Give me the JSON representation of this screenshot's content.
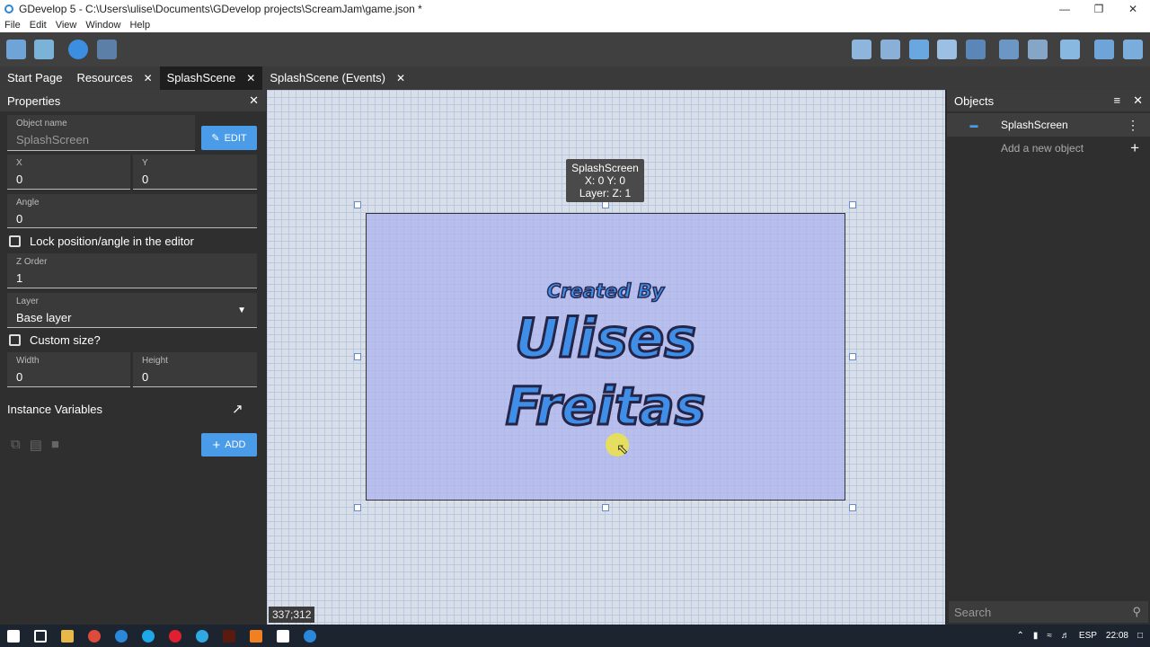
{
  "window": {
    "title": "GDevelop 5 - C:\\Users\\ulise\\Documents\\GDevelop projects\\ScreamJam\\game.json *"
  },
  "menu": [
    "File",
    "Edit",
    "View",
    "Window",
    "Help"
  ],
  "tabs": [
    {
      "label": "Start Page",
      "closable": false
    },
    {
      "label": "Resources",
      "closable": true
    },
    {
      "label": "SplashScene",
      "closable": true,
      "active": true
    },
    {
      "label": "SplashScene (Events)",
      "closable": true
    }
  ],
  "properties": {
    "title": "Properties",
    "object_name_label": "Object name",
    "object_name_value": "SplashScreen",
    "edit_label": "EDIT",
    "x_label": "X",
    "x_value": "0",
    "y_label": "Y",
    "y_value": "0",
    "angle_label": "Angle",
    "angle_value": "0",
    "lock_label": "Lock position/angle in the editor",
    "z_label": "Z Order",
    "z_value": "1",
    "layer_label": "Layer",
    "layer_value": "Base layer",
    "custom_size_label": "Custom size?",
    "width_label": "Width",
    "width_value": "0",
    "height_label": "Height",
    "height_value": "0",
    "instance_vars_label": "Instance Variables",
    "add_label": "ADD"
  },
  "canvas": {
    "tooltip_name": "SplashScreen",
    "tooltip_xy": "X: 0  Y: 0",
    "tooltip_layer": "Layer:   Z: 1",
    "scene_line1": "Created By",
    "scene_line2": "Ulises",
    "scene_line3": "Freitas",
    "coords": "337;312"
  },
  "objects": {
    "title": "Objects",
    "item": "SplashScreen",
    "add_new": "Add a new object",
    "search_placeholder": "Search"
  },
  "taskbar": {
    "lang": "ESP",
    "time": "22:08"
  }
}
